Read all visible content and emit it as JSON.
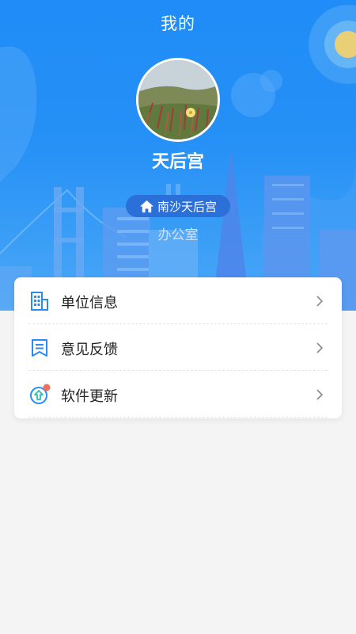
{
  "header": {
    "title": "我的",
    "background_color": "#2590f6"
  },
  "profile": {
    "name": "天后宫",
    "location": "南沙天后宫",
    "department": "办公室",
    "badge_color": "#2b6fd8"
  },
  "menu": {
    "items": [
      {
        "label": "单位信息",
        "icon": "building-icon"
      },
      {
        "label": "意见反馈",
        "icon": "feedback-icon"
      },
      {
        "label": "软件更新",
        "icon": "update-icon",
        "badge_dot_color": "#f0705a"
      }
    ],
    "icon_color": "#2a8cf0",
    "chevron": "chevron-right-icon"
  },
  "colors": {
    "page_background": "#f4f4f4",
    "card_background": "#ffffff",
    "sun_accent": "#e9cf77"
  }
}
